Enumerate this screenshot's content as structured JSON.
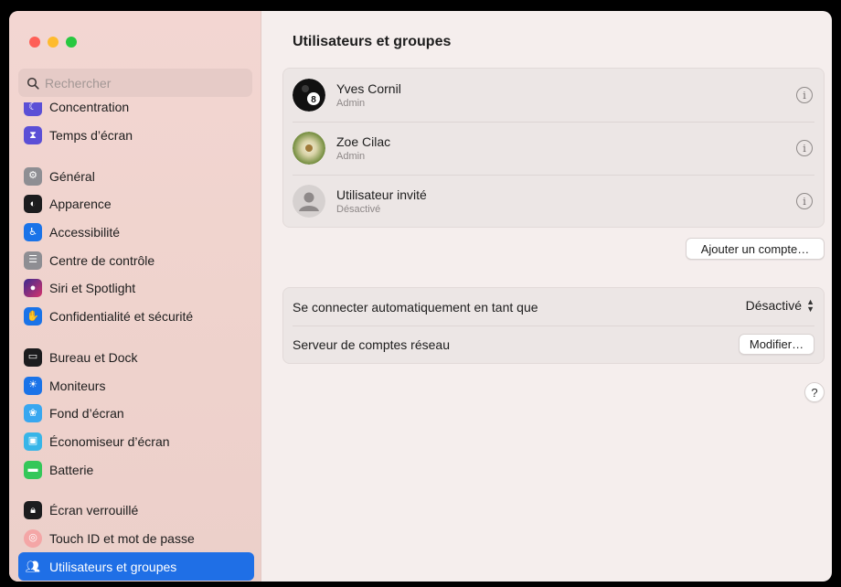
{
  "search": {
    "placeholder": "Rechercher"
  },
  "sidebar": {
    "items": [
      {
        "label": "Concentration",
        "icon": "moon-icon",
        "color": "#5b4fd6"
      },
      {
        "label": "Temps d’écran",
        "icon": "hourglass-icon",
        "color": "#5b4fd6"
      },
      {
        "label": "Général",
        "icon": "gear-icon",
        "color": "#8e8e93"
      },
      {
        "label": "Apparence",
        "icon": "appearance-icon",
        "color": "#1c1c1e"
      },
      {
        "label": "Accessibilité",
        "icon": "accessibility-icon",
        "color": "#1a73e8"
      },
      {
        "label": "Centre de contrôle",
        "icon": "control-center-icon",
        "color": "#8e8e93"
      },
      {
        "label": "Siri et Spotlight",
        "icon": "siri-icon",
        "color": "#3b2a8f"
      },
      {
        "label": "Confidentialité et sécurité",
        "icon": "hand-icon",
        "color": "#1a73e8"
      },
      {
        "label": "Bureau et Dock",
        "icon": "dock-icon",
        "color": "#1c1c1e"
      },
      {
        "label": "Moniteurs",
        "icon": "sun-icon",
        "color": "#1a73e8"
      },
      {
        "label": "Fond d’écran",
        "icon": "wallpaper-icon",
        "color": "#38a7f0"
      },
      {
        "label": "Économiseur d’écran",
        "icon": "screensaver-icon",
        "color": "#38b5e8"
      },
      {
        "label": "Batterie",
        "icon": "battery-icon",
        "color": "#34c759"
      },
      {
        "label": "Écran verrouillé",
        "icon": "lock-icon",
        "color": "#1c1c1e"
      },
      {
        "label": "Touch ID et mot de passe",
        "icon": "fingerprint-icon",
        "color": "#f4a6a6"
      },
      {
        "label": "Utilisateurs et groupes",
        "icon": "users-icon",
        "color": "#1a73e8"
      }
    ]
  },
  "main": {
    "title": "Utilisateurs et groupes",
    "users": [
      {
        "name": "Yves Cornil",
        "role": "Admin",
        "avatar": "eight-ball-avatar"
      },
      {
        "name": "Zoe Cilac",
        "role": "Admin",
        "avatar": "dandelion-avatar"
      },
      {
        "name": "Utilisateur invité",
        "role": "Désactivé",
        "avatar": "guest-avatar"
      }
    ],
    "add_account_label": "Ajouter un compte…",
    "auto_login_label": "Se connecter automatiquement en tant que",
    "auto_login_value": "Désactivé",
    "network_server_label": "Serveur de comptes réseau",
    "modify_label": "Modifier…",
    "help_label": "?",
    "info_glyph": "i"
  },
  "accent_color": "#1f6fe6"
}
